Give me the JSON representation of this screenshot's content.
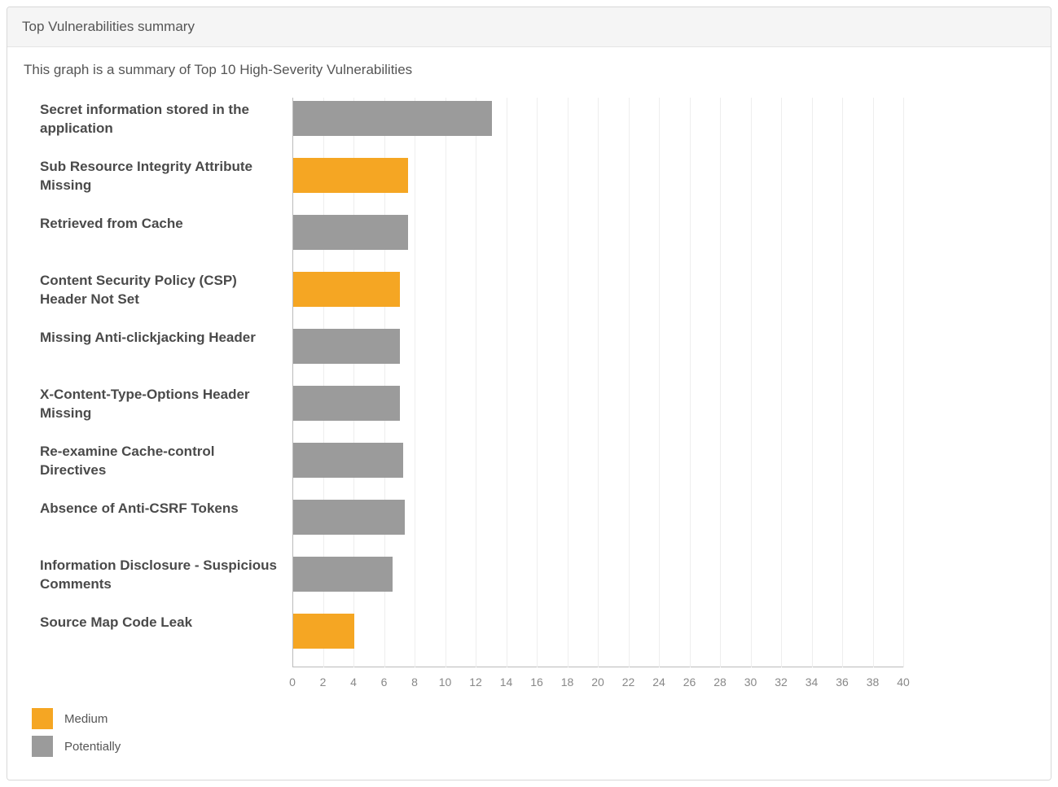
{
  "panel": {
    "title": "Top Vulnerabilities summary",
    "subtitle": "This graph is a summary of Top 10 High-Severity Vulnerabilities"
  },
  "legend": {
    "items": [
      {
        "label": "Medium",
        "class": "medium"
      },
      {
        "label": "Potentially",
        "class": "potentially"
      }
    ]
  },
  "chart_data": {
    "type": "bar",
    "orientation": "horizontal",
    "xlabel": "",
    "ylabel": "",
    "xlim": [
      0,
      40
    ],
    "x_ticks": [
      0,
      2,
      4,
      6,
      8,
      10,
      12,
      14,
      16,
      18,
      20,
      22,
      24,
      26,
      28,
      30,
      32,
      34,
      36,
      38,
      40
    ],
    "categories": [
      "Secret information stored in the application",
      "Sub Resource Integrity Attribute Missing",
      "Retrieved from Cache",
      "Content Security Policy (CSP) Header Not Set",
      "Missing Anti-clickjacking Header",
      "X-Content-Type-Options Header Missing",
      "Re-examine Cache-control Directives",
      "Absence of Anti-CSRF Tokens",
      "Information Disclosure - Suspicious Comments",
      "Source Map Code Leak"
    ],
    "series": [
      {
        "name": "Medium",
        "values": [
          null,
          7.5,
          null,
          7.0,
          null,
          null,
          null,
          null,
          null,
          4.0
        ]
      },
      {
        "name": "Potentially",
        "values": [
          13.0,
          null,
          7.5,
          null,
          7.0,
          7.0,
          7.2,
          7.3,
          6.5,
          null
        ]
      }
    ],
    "colors": {
      "Medium": "#f5a623",
      "Potentially": "#9b9b9b"
    }
  }
}
